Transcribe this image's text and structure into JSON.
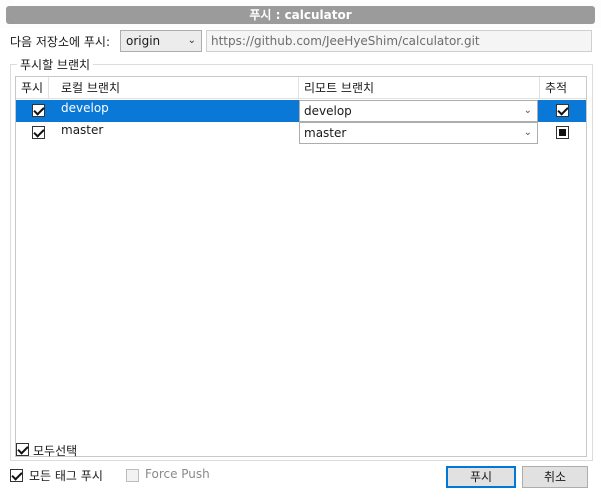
{
  "window": {
    "title": "푸시 : calculator"
  },
  "remote": {
    "label": "다음 저장소에 푸시:",
    "selected": "origin",
    "url": "https://github.com/JeeHyeShim/calculator.git"
  },
  "branches_group": {
    "legend": "푸시할 브랜치",
    "columns": {
      "push": "푸시",
      "local": "로컬 브랜치",
      "remote": "리모트 브랜치",
      "track": "추적"
    },
    "rows": [
      {
        "local": "develop",
        "remote": "develop",
        "push": true,
        "track": "checked",
        "selected": true
      },
      {
        "local": "master",
        "remote": "master",
        "push": true,
        "track": "filled",
        "selected": false
      }
    ]
  },
  "select_all": {
    "label": "모두선택",
    "checked": true
  },
  "options": {
    "push_all_tags": {
      "label": "모든 태그 푸시",
      "checked": true
    },
    "force_push": {
      "label": "Force Push",
      "checked": false
    }
  },
  "buttons": {
    "push": "푸시",
    "cancel": "취소"
  }
}
